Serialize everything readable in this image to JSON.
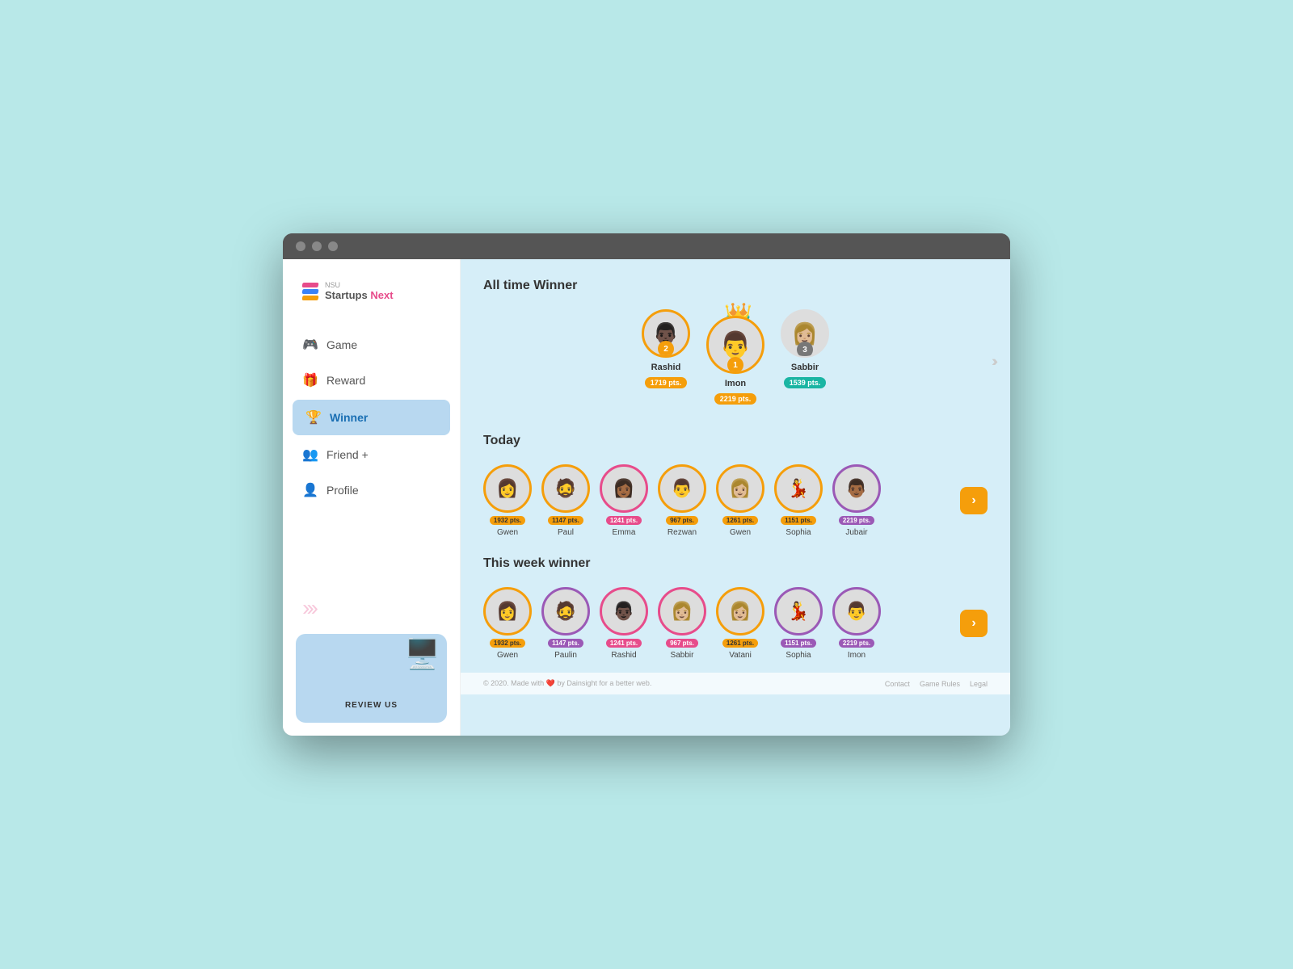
{
  "browser": {
    "dots": [
      "d1",
      "d2",
      "d3"
    ]
  },
  "sidebar": {
    "logo": {
      "nsu": "NSU",
      "brand_start": "Startups",
      "brand_end": "Next"
    },
    "nav": [
      {
        "id": "game",
        "label": "Game",
        "icon": "🎮",
        "active": false
      },
      {
        "id": "reward",
        "label": "Reward",
        "icon": "🎁",
        "active": false
      },
      {
        "id": "winner",
        "label": "Winner",
        "icon": "🏆",
        "active": true
      },
      {
        "id": "friend",
        "label": "Friend +",
        "icon": "👥",
        "active": false
      },
      {
        "id": "profile",
        "label": "Profile",
        "icon": "👤",
        "active": false
      }
    ],
    "review_label": "REVIEW US"
  },
  "main": {
    "all_time_winner": {
      "title": "All time Winner",
      "winners": [
        {
          "rank": 2,
          "name": "Rashid",
          "points": "1719 pts.",
          "badge_class": "pts-gold",
          "avatar_bg": "#c0392b"
        },
        {
          "rank": 1,
          "name": "Imon",
          "points": "2219 pts.",
          "badge_class": "pts-gold",
          "avatar_bg": "#2c3e50"
        },
        {
          "rank": 3,
          "name": "Sabbir",
          "points": "1539 pts.",
          "badge_class": "pts-gold",
          "avatar_bg": "#e8a0b0"
        }
      ]
    },
    "today": {
      "title": "Today",
      "players": [
        {
          "name": "Gwen",
          "points": "1932 pts.",
          "border": "border-gold",
          "pts_class": "pts-yellow",
          "face": "👩"
        },
        {
          "name": "Paul",
          "points": "1147 pts.",
          "border": "border-gold",
          "pts_class": "pts-yellow",
          "face": "🧔"
        },
        {
          "name": "Emma",
          "points": "1241 pts.",
          "border": "border-pink",
          "pts_class": "pts-pink-bg",
          "face": "👩"
        },
        {
          "name": "Rezwan",
          "points": "967 pts.",
          "border": "border-gold",
          "pts_class": "pts-yellow",
          "face": "👨"
        },
        {
          "name": "Gwen",
          "points": "1261 pts.",
          "border": "border-gold",
          "pts_class": "pts-yellow",
          "face": "👩"
        },
        {
          "name": "Sophia",
          "points": "1151 pts.",
          "border": "border-gold",
          "pts_class": "pts-yellow",
          "face": "💃"
        },
        {
          "name": "Jubair",
          "points": "2219 pts.",
          "border": "border-purple",
          "pts_class": "pts-purple-bg",
          "face": "👨"
        }
      ],
      "next_label": "›"
    },
    "week": {
      "title": "This week winner",
      "players": [
        {
          "name": "Gwen",
          "points": "1932 pts.",
          "border": "border-gold",
          "pts_class": "pts-yellow",
          "face": "👩"
        },
        {
          "name": "Paulin",
          "points": "1147 pts.",
          "border": "border-purple",
          "pts_class": "pts-purple-bg",
          "face": "🧔"
        },
        {
          "name": "Rashid",
          "points": "1241 pts.",
          "border": "border-pink",
          "pts_class": "pts-pink-bg",
          "face": "👨"
        },
        {
          "name": "Sabbir",
          "points": "967 pts.",
          "border": "border-pink",
          "pts_class": "pts-pink-bg",
          "face": "👩"
        },
        {
          "name": "Vatani",
          "points": "1261 pts.",
          "border": "border-gold",
          "pts_class": "pts-yellow",
          "face": "👩"
        },
        {
          "name": "Sophia",
          "points": "1151 pts.",
          "border": "border-purple",
          "pts_class": "pts-purple-bg",
          "face": "💃"
        },
        {
          "name": "Imon",
          "points": "2219 pts.",
          "border": "border-purple",
          "pts_class": "pts-purple-bg",
          "face": "👨"
        }
      ],
      "next_label": "›"
    }
  },
  "footer": {
    "copyright": "© 2020. Made with ❤️ by Dainsight for a better web.",
    "links": [
      "Contact",
      "Game Rules",
      "Legal"
    ]
  }
}
